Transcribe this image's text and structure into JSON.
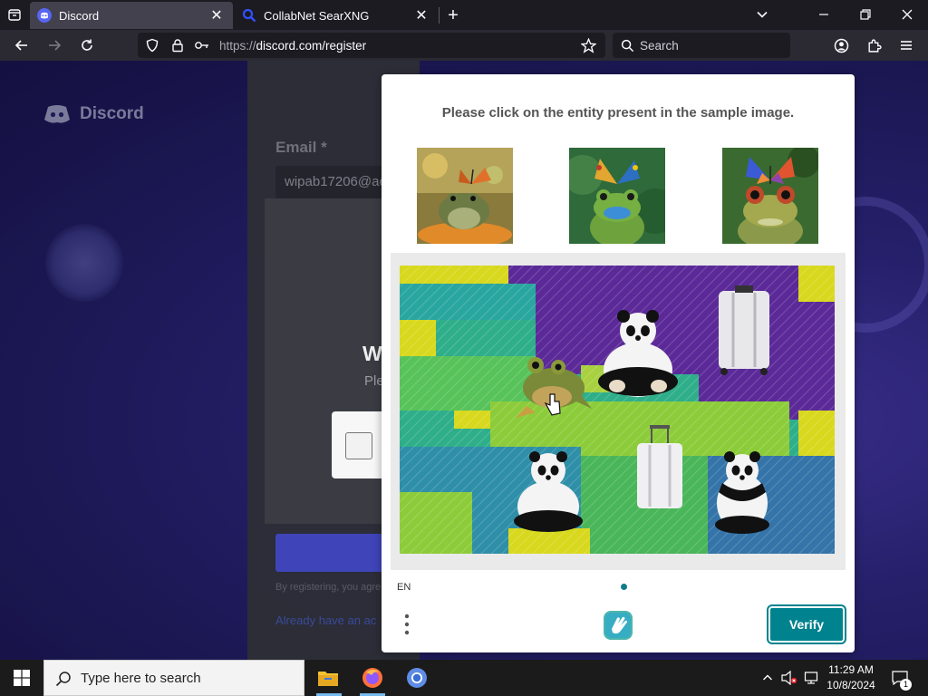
{
  "browser": {
    "tabs": [
      {
        "title": "Discord",
        "active": true
      },
      {
        "title": "CollabNet SearXNG",
        "active": false
      }
    ],
    "url_scheme": "https://",
    "url_rest": "discord.com/register",
    "search_placeholder": "Search"
  },
  "page": {
    "brand": "Discord",
    "email_label": "Email",
    "email_required": " *",
    "email_value": "wipab17206@ac",
    "welcome_fragment": "W",
    "please_fragment": "Ple",
    "legal_fragment": "By registering, you agre",
    "already_fragment": "Already have an ac"
  },
  "captcha": {
    "prompt": "Please click on the entity present in the sample image.",
    "language": "EN",
    "verify_label": "Verify",
    "sample_subjects": [
      "frog-with-butterfly",
      "frog-with-butterfly",
      "frog-with-butterfly"
    ],
    "grid_objects": [
      "frog",
      "panda",
      "suitcase",
      "suitcase",
      "panda",
      "panda"
    ]
  },
  "taskbar": {
    "search_placeholder": "Type here to search",
    "time": "11:29 AM",
    "date": "10/8/2024",
    "notification_count": "1"
  },
  "colors": {
    "accent": "#00838f",
    "discord_blurple": "#5865f2",
    "page_bg": "#1b1752"
  }
}
